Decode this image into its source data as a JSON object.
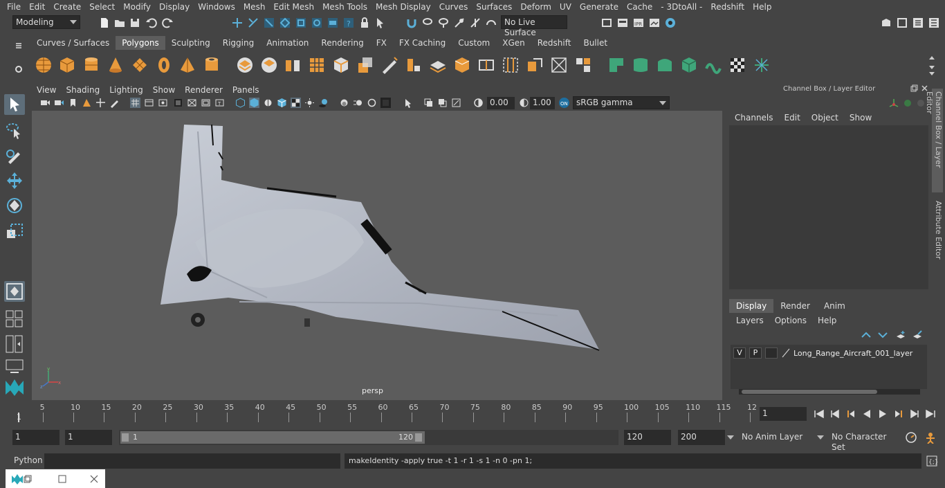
{
  "menubar": [
    "File",
    "Edit",
    "Create",
    "Select",
    "Modify",
    "Display",
    "Windows",
    "Mesh",
    "Edit Mesh",
    "Mesh Tools",
    "Mesh Display",
    "Curves",
    "Surfaces",
    "Deform",
    "UV",
    "Generate",
    "Cache",
    "- 3DtoAll -",
    "Redshift",
    "Help"
  ],
  "status": {
    "mode": "Modeling",
    "live_surface": "No Live Surface"
  },
  "shelf_tabs": [
    "Curves / Surfaces",
    "Polygons",
    "Sculpting",
    "Rigging",
    "Animation",
    "Rendering",
    "FX",
    "FX Caching",
    "Custom",
    "XGen",
    "Redshift",
    "Bullet"
  ],
  "shelf_active": "Polygons",
  "viewport": {
    "menu": [
      "View",
      "Shading",
      "Lighting",
      "Show",
      "Renderer",
      "Panels"
    ],
    "exposure": "0.00",
    "gamma": "1.00",
    "color_space": "sRGB gamma",
    "camera_label": "persp"
  },
  "channel_box": {
    "title": "Channel Box / Layer Editor",
    "menu": [
      "Channels",
      "Edit",
      "Object",
      "Show"
    ]
  },
  "layer_editor": {
    "tabs": [
      "Display",
      "Render",
      "Anim"
    ],
    "active_tab": "Display",
    "menu": [
      "Layers",
      "Options",
      "Help"
    ],
    "layer": {
      "v": "V",
      "p": "P",
      "name": "Long_Range_Aircraft_001_layer"
    }
  },
  "side_tabs": [
    "Channel Box / Layer Editor",
    "Attribute Editor"
  ],
  "timeline": {
    "ticks": [
      "5",
      "10",
      "15",
      "20",
      "25",
      "30",
      "35",
      "40",
      "45",
      "50",
      "55",
      "60",
      "65",
      "70",
      "75",
      "80",
      "85",
      "90",
      "95",
      "100",
      "105",
      "110",
      "115",
      "12"
    ],
    "start_label": "1",
    "current_frame": "1"
  },
  "range": {
    "start": "1",
    "playback_start": "1",
    "slider_start": "1",
    "slider_end": "120",
    "playback_end": "120",
    "end": "200",
    "anim_layer": "No Anim Layer",
    "char_set": "No Character Set"
  },
  "command": {
    "lang": "Python",
    "output": "makeIdentity -apply true -t 1 -r 1 -s 1 -n 0 -pn 1;"
  },
  "colors": {
    "accent": "#5bb0d8",
    "shelf_green": "#3fa67a",
    "active_tab": "#5d5d5d"
  }
}
